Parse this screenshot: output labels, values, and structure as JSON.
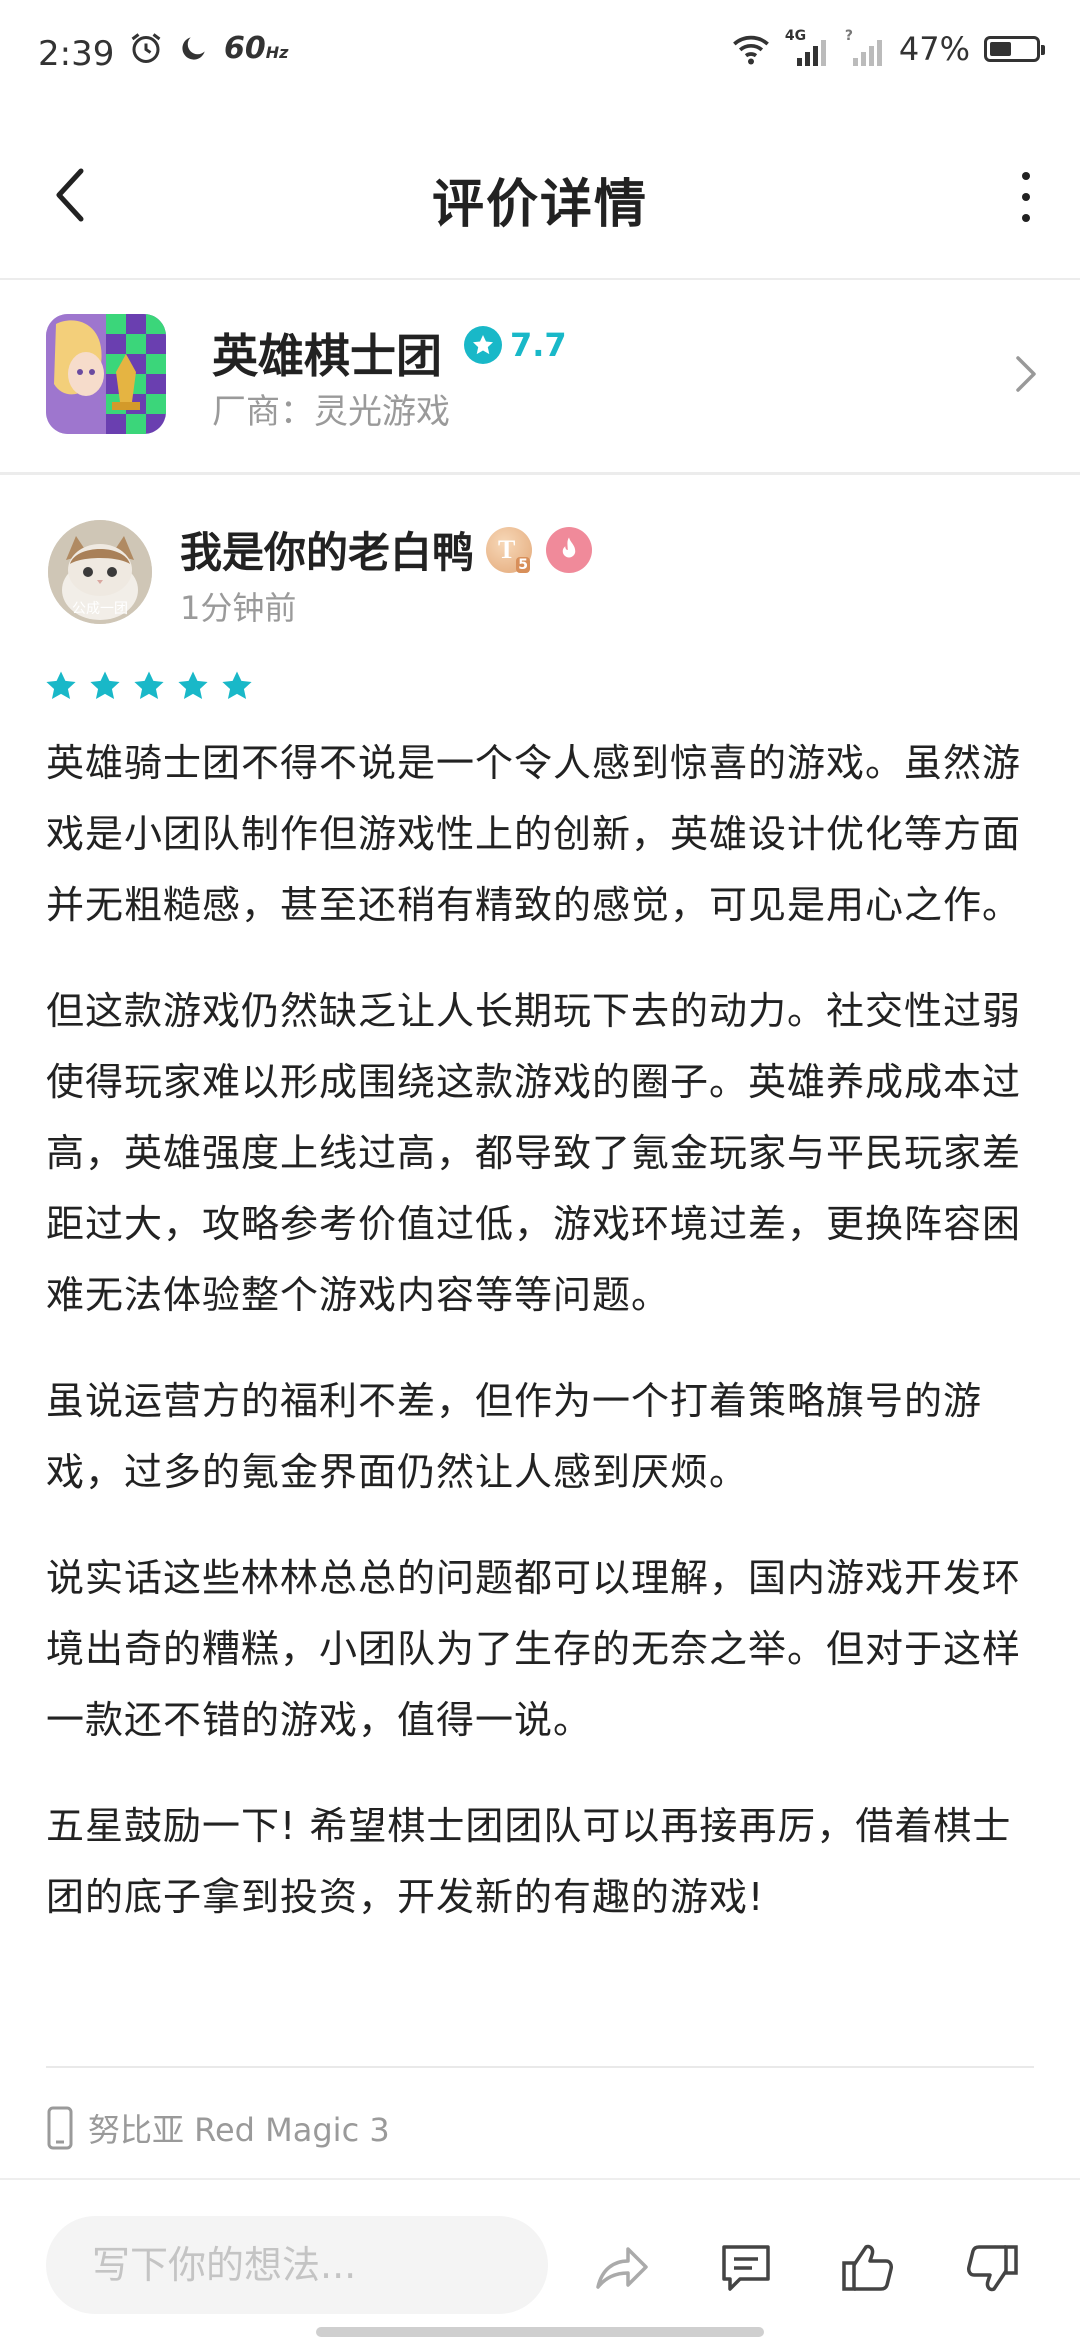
{
  "status_bar": {
    "time": "2:39",
    "refresh_rate": "60",
    "refresh_unit": "Hz",
    "network": "4G",
    "battery_percent": "47%",
    "battery_level": 0.47
  },
  "header": {
    "title": "评价详情"
  },
  "game": {
    "name": "英雄棋士团",
    "rating": "7.7",
    "vendor": "厂商：灵光游戏"
  },
  "review": {
    "username": "我是你的老白鸭",
    "avatar_caption": "公成一团",
    "level_letter": "T",
    "level_number": "5",
    "time": "1分钟前",
    "stars": 5,
    "paragraphs": [
      "英雄骑士团不得不说是一个令人感到惊喜的游戏。虽然游戏是小团队制作但游戏性上的创新，英雄设计优化等方面并无粗糙感，甚至还稍有精致的感觉，可见是用心之作。",
      "但这款游戏仍然缺乏让人长期玩下去的动力。社交性过弱使得玩家难以形成围绕这款游戏的圈子。英雄养成成本过高，英雄强度上线过高，都导致了氪金玩家与平民玩家差距过大，攻略参考价值过低，游戏环境过差，更换阵容困难无法体验整个游戏内容等等问题。",
      "虽说运营方的福利不差，但作为一个打着策略旗号的游戏，过多的氪金界面仍然让人感到厌烦。",
      "说实话这些林林总总的问题都可以理解，国内游戏开发环境出奇的糟糕，小团队为了生存的无奈之举。但对于这样一款还不错的游戏，值得一说。",
      "五星鼓励一下! 希望棋士团团队可以再接再厉，借着棋士团的底子拿到投资，开发新的有趣的游戏!"
    ],
    "device": "努比亚 Red Magic 3"
  },
  "bottom_bar": {
    "input_placeholder": "写下你的想法..."
  },
  "colors": {
    "accent": "#19b8c8",
    "star": "#19b8c8",
    "text_primary": "#222222",
    "text_secondary": "#9a9a9a"
  },
  "icons": [
    "back-arrow-icon",
    "more-vertical-icon",
    "chevron-right-icon",
    "star-icon",
    "phone-icon",
    "share-icon",
    "comment-icon",
    "thumbs-up-icon",
    "thumbs-down-icon",
    "wifi-icon",
    "signal-icon",
    "alarm-icon",
    "moon-icon",
    "fire-icon"
  ]
}
